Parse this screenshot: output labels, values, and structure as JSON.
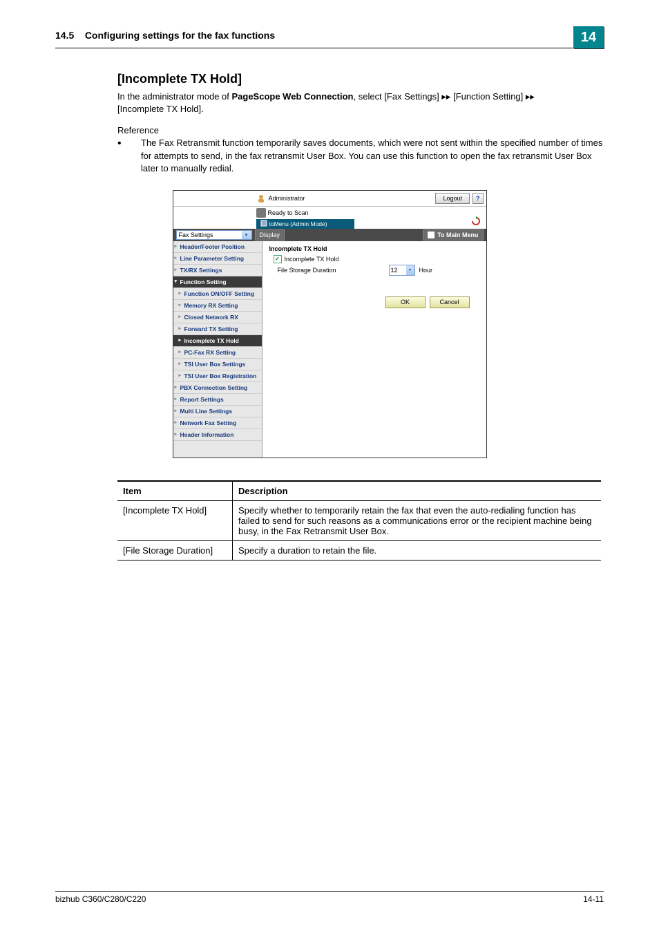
{
  "header": {
    "section_num": "14.5",
    "section_title": "Configuring settings for the fax functions",
    "chapter_num": "14"
  },
  "section": {
    "title": "[Incomplete TX Hold]",
    "intro_part1": "In the administrator mode of ",
    "intro_bold": "PageScope Web Connection",
    "intro_part2": ", select [Fax Settings]",
    "intro_arrow": "▸▸",
    "intro_part3": "[Function Setting]",
    "intro_part4": "[Incomplete TX Hold].",
    "reference_label": "Reference",
    "bullet1": "The Fax Retransmit function temporarily saves documents, which were not sent within the specified number of times for attempts to send, in the fax retransmit User Box. You can use this function to open the fax retransmit User Box later to manually redial."
  },
  "screenshot": {
    "top": {
      "admin_label": "Administrator",
      "logout": "Logout",
      "help": "?",
      "ready": "Ready to Scan",
      "menu_mode": "toMenu (Admin Mode)"
    },
    "toolbar": {
      "dropdown": "Fax Settings",
      "display": "Display",
      "main_menu": "To Main Menu"
    },
    "sidebar": {
      "items": [
        "Header/Footer Position",
        "Line Parameter Setting",
        "TX/RX Settings",
        "Function Setting"
      ],
      "subs": [
        "Function ON/OFF Setting",
        "Memory RX Setting",
        "Closed Network RX",
        "Forward TX Setting",
        "Incomplete TX Hold",
        "PC-Fax RX Setting",
        "TSI User Box Settings",
        "TSI User Box Registration"
      ],
      "items_after": [
        "PBX Connection Setting",
        "Report Settings",
        "Multi Line Settings",
        "Network Fax Setting",
        "Header Information"
      ]
    },
    "content": {
      "title": "Incomplete TX Hold",
      "checkbox_label": "Incomplete TX Hold",
      "duration_label": "File Storage Duration",
      "duration_value": "12",
      "duration_unit": "Hour",
      "ok": "OK",
      "cancel": "Cancel"
    }
  },
  "table": {
    "head_item": "Item",
    "head_desc": "Description",
    "rows": [
      {
        "item": "[Incomplete TX Hold]",
        "desc": "Specify whether to temporarily retain the fax that even the auto-redialing function has failed to send for such reasons as a communications error or the recipient machine being busy, in the Fax Retransmit User Box."
      },
      {
        "item": "[File Storage Duration]",
        "desc": "Specify a duration to retain the file."
      }
    ]
  },
  "footer": {
    "model": "bizhub C360/C280/C220",
    "page": "14-11"
  }
}
